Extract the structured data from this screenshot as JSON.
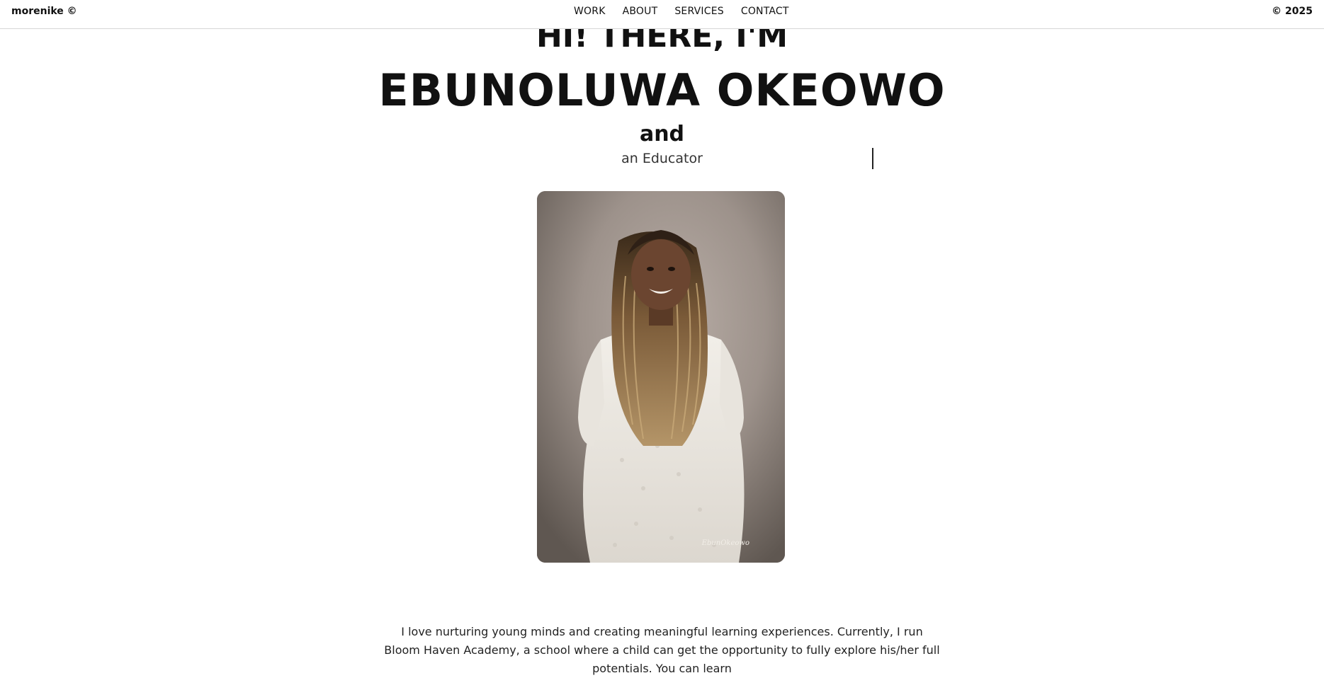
{
  "header": {
    "brand": "morenike ©",
    "nav": [
      {
        "label": "WORK"
      },
      {
        "label": "ABOUT"
      },
      {
        "label": "SERVICES"
      },
      {
        "label": "CONTACT"
      }
    ],
    "copyright": "© 2025"
  },
  "hero": {
    "greeting": "HI! THERE, I'M",
    "name": "EBUNOLUWA OKEOWO",
    "connector": "and",
    "role": "an Educator"
  },
  "portrait": {
    "signature": "EbunOkeowo"
  },
  "bio": {
    "text": "I love nurturing young minds and creating meaningful learning experiences. Currently, I run Bloom Haven Academy, a school where a child can get the opportunity to fully explore his/her full potentials. You can learn"
  },
  "colors": {
    "text": "#111111",
    "border": "#d6d6d6",
    "photo_backdrop": "#9f948d"
  }
}
